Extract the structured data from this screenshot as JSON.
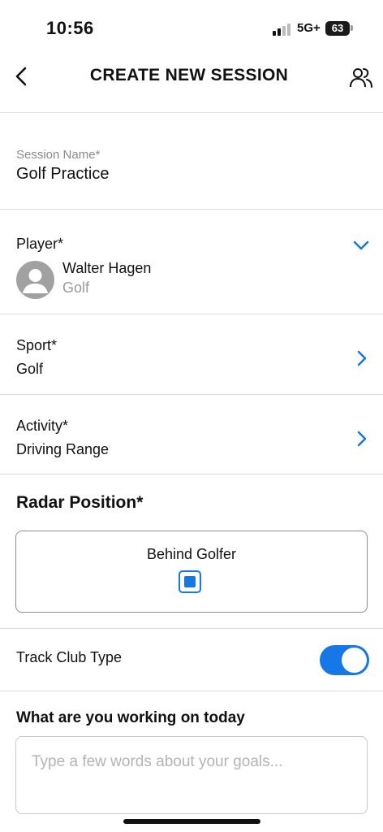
{
  "status_bar": {
    "time": "10:56",
    "network": "5G+",
    "battery": "63"
  },
  "header": {
    "title": "CREATE NEW SESSION",
    "back_icon": "chevron-left-icon",
    "people_icon": "people-icon"
  },
  "session_name": {
    "label": "Session Name*",
    "value": "Golf Practice"
  },
  "player": {
    "label": "Player*",
    "name": "Walter Hagen",
    "sport": "Golf"
  },
  "sport": {
    "label": "Sport*",
    "value": "Golf"
  },
  "activity": {
    "label": "Activity*",
    "value": "Driving Range"
  },
  "radar": {
    "title": "Radar Position*",
    "option_label": "Behind Golfer",
    "selected": true
  },
  "track_club": {
    "label": "Track Club Type",
    "enabled": true
  },
  "goals": {
    "title": "What are you working on today",
    "placeholder": "Type a few words about your goals...",
    "value": ""
  },
  "colors": {
    "accent": "#1677e6",
    "divider": "#dcdcdc",
    "muted": "#8a8a8a"
  }
}
